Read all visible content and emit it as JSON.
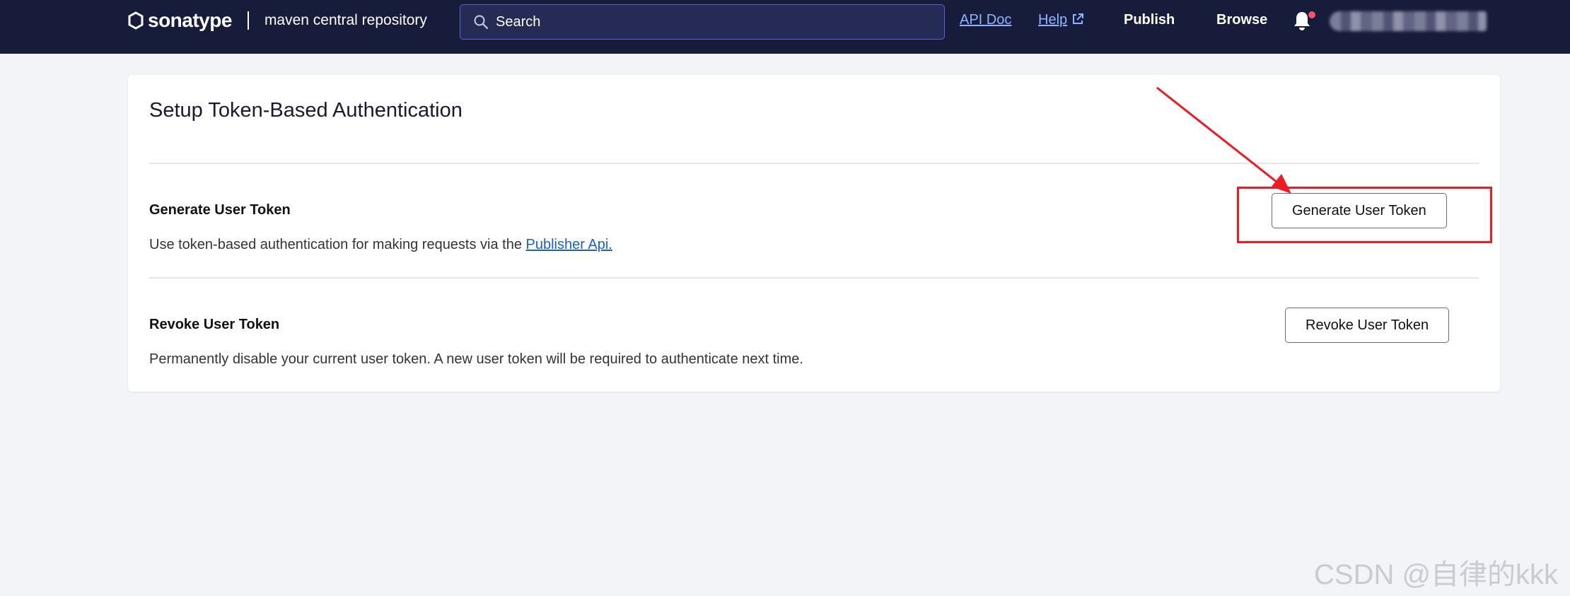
{
  "header": {
    "brand": "sonatype",
    "product": "maven central repository",
    "search_placeholder": "Search",
    "api_doc_label": "API Doc",
    "help_label": "Help",
    "publish_label": "Publish",
    "browse_label": "Browse"
  },
  "page": {
    "title": "Setup Token-Based Authentication",
    "generate": {
      "title": "Generate User Token",
      "description_prefix": "Use token-based authentication for making requests via the ",
      "link_label": "Publisher Api.",
      "button_label": "Generate User Token"
    },
    "revoke": {
      "title": "Revoke User Token",
      "description": "Permanently disable your current user token. A new user token will be required to authenticate next time.",
      "button_label": "Revoke User Token"
    }
  },
  "watermark": "CSDN @自律的kkk",
  "colors": {
    "topbar": "#181c3b",
    "background": "#f3f4f8",
    "link": "#8fb3ff",
    "annotation": "#ee1b24",
    "notification_dot": "#ff4d6d"
  },
  "icons": [
    "sonatype-logo-icon",
    "search-icon",
    "external-link-icon",
    "bell-icon"
  ]
}
